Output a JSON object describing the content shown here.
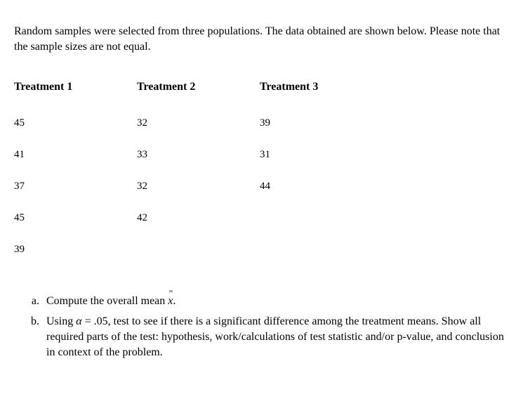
{
  "intro": "Random samples were selected from three populations. The data obtained are shown below. Please note that the sample sizes are not equal.",
  "table": {
    "headers": [
      "Treatment 1",
      "Treatment 2",
      "Treatment 3"
    ],
    "rows": [
      [
        "45",
        "32",
        "39"
      ],
      [
        "41",
        "33",
        "31"
      ],
      [
        "37",
        "32",
        "44"
      ],
      [
        "45",
        "42",
        ""
      ],
      [
        "39",
        "",
        ""
      ]
    ]
  },
  "questions": {
    "a_pre": "Compute the overall mean ",
    "a_post": ".",
    "b_pre": "Using ",
    "b_alpha": "α",
    "b_post": " = .05, test to see if there is a significant difference among the treatment means. Show all required parts of the test: hypothesis, work/calculations of test statistic and/or p-value, and conclusion in context of the problem."
  }
}
